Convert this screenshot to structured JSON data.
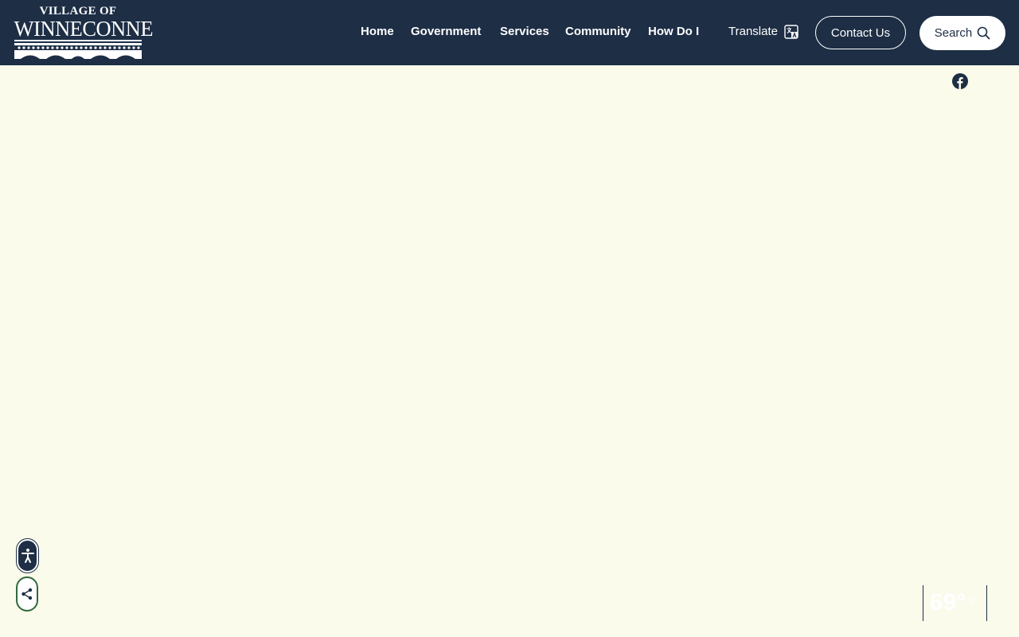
{
  "logo": {
    "top_text": "VILLAGE OF",
    "main_text": "WINNECONNE"
  },
  "nav": {
    "items": [
      {
        "label": "Home"
      },
      {
        "label": "Government"
      },
      {
        "label": "Services"
      },
      {
        "label": "Community"
      },
      {
        "label": "How Do I"
      }
    ],
    "translate_label": "Translate",
    "contact_label": "Contact Us",
    "search_label": "Search"
  },
  "social": {
    "facebook_icon": "facebook-icon"
  },
  "widgets": {
    "accessibility_icon": "accessibility-icon",
    "share_icon": "share-icon"
  },
  "weather": {
    "temperature": "69°",
    "unit": "F"
  },
  "colors": {
    "header_bg": "#1d2e45",
    "page_bg": "#fafbeb",
    "share_border": "#2f6a3c"
  }
}
